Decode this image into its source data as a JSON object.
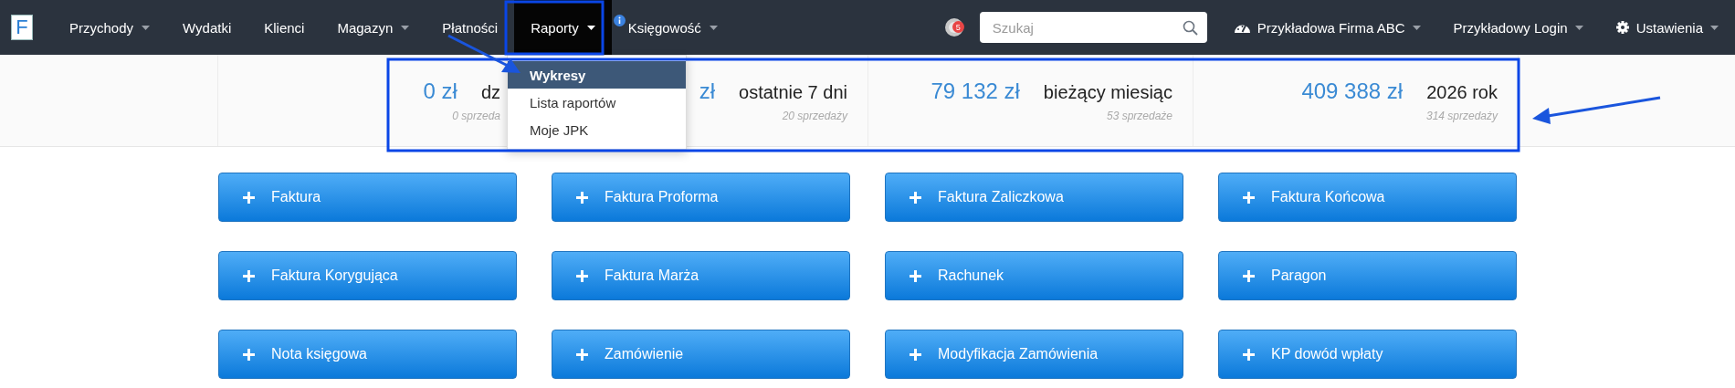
{
  "navbar": {
    "logo": "F",
    "items": [
      {
        "label": "Przychody",
        "dropdown": true,
        "selected": false,
        "info": false
      },
      {
        "label": "Wydatki",
        "dropdown": false,
        "selected": false,
        "info": false
      },
      {
        "label": "Klienci",
        "dropdown": false,
        "selected": false,
        "info": false
      },
      {
        "label": "Magazyn",
        "dropdown": true,
        "selected": false,
        "info": false
      },
      {
        "label": "Płatności",
        "dropdown": false,
        "selected": false,
        "info": false
      },
      {
        "label": "Raporty",
        "dropdown": true,
        "selected": true,
        "info": false
      },
      {
        "label": "Księgowość",
        "dropdown": true,
        "selected": false,
        "info": true
      }
    ],
    "notifications": {
      "count": "5"
    },
    "search": {
      "placeholder": "Szukaj"
    },
    "right_items": [
      {
        "label": "Przykładowa Firma ABC",
        "kind": "company"
      },
      {
        "label": "Przykładowy Login",
        "kind": "user"
      },
      {
        "label": "Ustawienia",
        "kind": "settings"
      }
    ]
  },
  "dropdown": {
    "items": [
      {
        "label": "Wykresy",
        "selected": true
      },
      {
        "label": "Lista raportów",
        "selected": false
      },
      {
        "label": "Moje JPK",
        "selected": false
      }
    ]
  },
  "stats": [
    {
      "value": "0 zł",
      "label": "dz",
      "sales": "0 sprzeda"
    },
    {
      "value": "zł",
      "label": "ostatnie 7 dni",
      "sales": "20 sprzedaży"
    },
    {
      "value": "79 132 zł",
      "label": "bieżący miesiąc",
      "sales": "53 sprzedaże"
    },
    {
      "value": "409 388 zł",
      "label": "2026 rok",
      "sales": "314 sprzedaży"
    }
  ],
  "actions": [
    "Faktura",
    "Faktura Proforma",
    "Faktura Zaliczkowa",
    "Faktura Końcowa",
    "Faktura Korygująca",
    "Faktura Marża",
    "Rachunek",
    "Paragon",
    "Nota księgowa",
    "Zamówienie",
    "Modyfikacja Zamówienia",
    "KP dowód wpłaty"
  ]
}
